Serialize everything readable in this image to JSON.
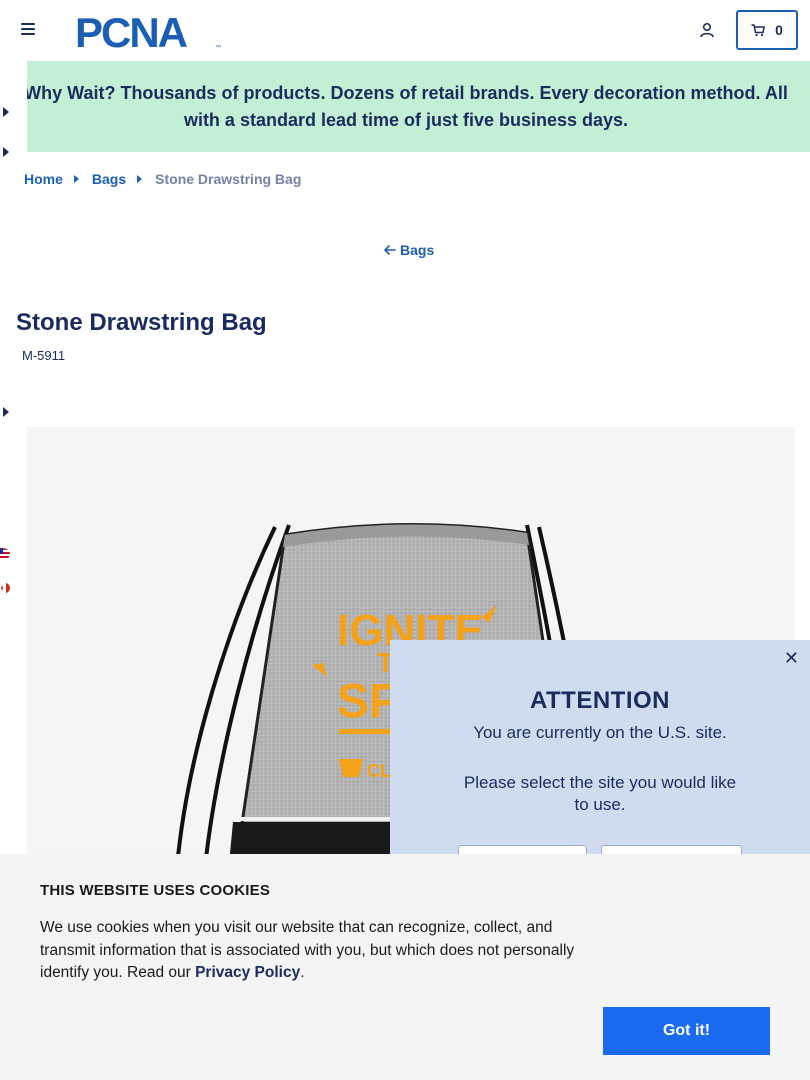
{
  "header": {
    "logo_text": "PCNA",
    "cart_count": "0",
    "menu_icon": "hamburger-menu-icon",
    "account_icon": "user-icon",
    "cart_icon": "shopping-cart-icon"
  },
  "banner": {
    "text": "Why Wait? Thousands of products. Dozens of retail brands. Every decoration method. All with a standard lead time of just five business days."
  },
  "breadcrumb": {
    "items": [
      "Home",
      "Bags"
    ],
    "current": "Stone Drawstring Bag"
  },
  "back_link": {
    "label": "Bags"
  },
  "product": {
    "title": "Stone Drawstring Bag",
    "sku": "M-5911",
    "image_print_lines": [
      "IGNITE",
      "T",
      "SPA",
      "CL"
    ]
  },
  "site_modal": {
    "heading": "ATTENTION",
    "line1": "You are currently on the U.S. site.",
    "line2": "Please select the site you would like to use."
  },
  "cookie": {
    "title": "THIS WEBSITE USES COOKIES",
    "text_before": "We use cookies when you visit our website that can recognize, collect, and transmit information that is associated with you, but which does not personally identify you. Read our ",
    "link": "Privacy Policy",
    "text_after": ".",
    "button": "Got it!"
  },
  "colors": {
    "brand_navy": "#1a2b5e",
    "link_blue": "#1a5fb4",
    "banner_green": "#c3f0d4",
    "modal_blue": "#cfdcf0",
    "cookie_button": "#1a6bf0",
    "print_orange": "#f5a21b"
  }
}
